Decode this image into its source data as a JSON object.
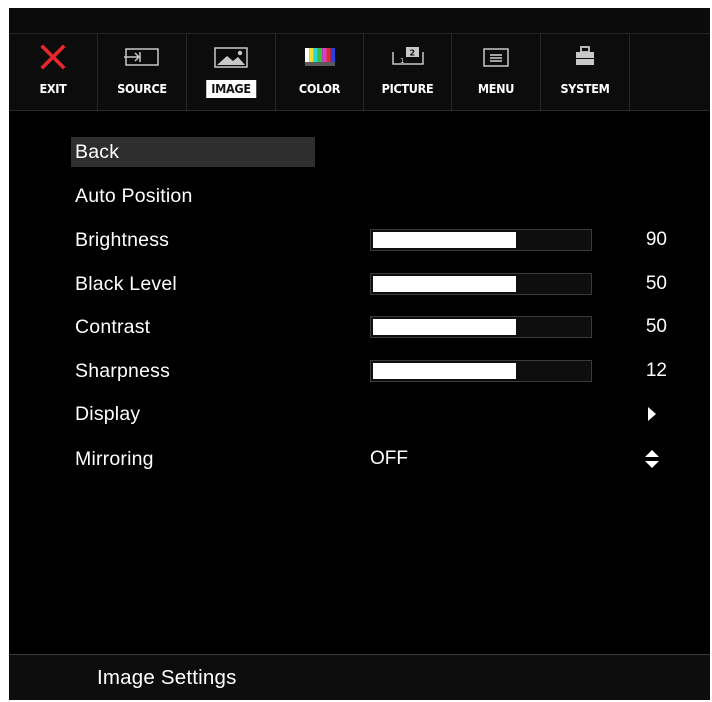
{
  "tabs": [
    {
      "label": "EXIT",
      "icon": "close-icon",
      "selected": false
    },
    {
      "label": "SOURCE",
      "icon": "input-source-icon",
      "selected": false
    },
    {
      "label": "IMAGE",
      "icon": "image-icon",
      "selected": true
    },
    {
      "label": "COLOR",
      "icon": "color-bars-icon",
      "selected": false
    },
    {
      "label": "PICTURE",
      "icon": "picture-in-picture-icon",
      "selected": false
    },
    {
      "label": "MENU",
      "icon": "menu-icon",
      "selected": false
    },
    {
      "label": "SYSTEM",
      "icon": "toolbox-icon",
      "selected": false
    }
  ],
  "menu": {
    "back_label": "Back",
    "auto_position_label": "Auto Position",
    "brightness": {
      "label": "Brightness",
      "value": "90",
      "level": 0.66
    },
    "black_level": {
      "label": "Black Level",
      "value": "50",
      "level": 0.66
    },
    "contrast": {
      "label": "Contrast",
      "value": "50",
      "level": 0.66
    },
    "sharpness": {
      "label": "Sharpness",
      "value": "12",
      "level": 0.66
    },
    "display_label": "Display",
    "mirroring": {
      "label": "Mirroring",
      "value": "OFF"
    }
  },
  "footer": {
    "title": "Image Settings"
  },
  "colors": {
    "exit_icon": "#e8262b",
    "selected_tab_bg": "#ffffff",
    "highlight_row": "#2e2e2e",
    "slider_fill": "#ffffff",
    "background": "#000000"
  }
}
